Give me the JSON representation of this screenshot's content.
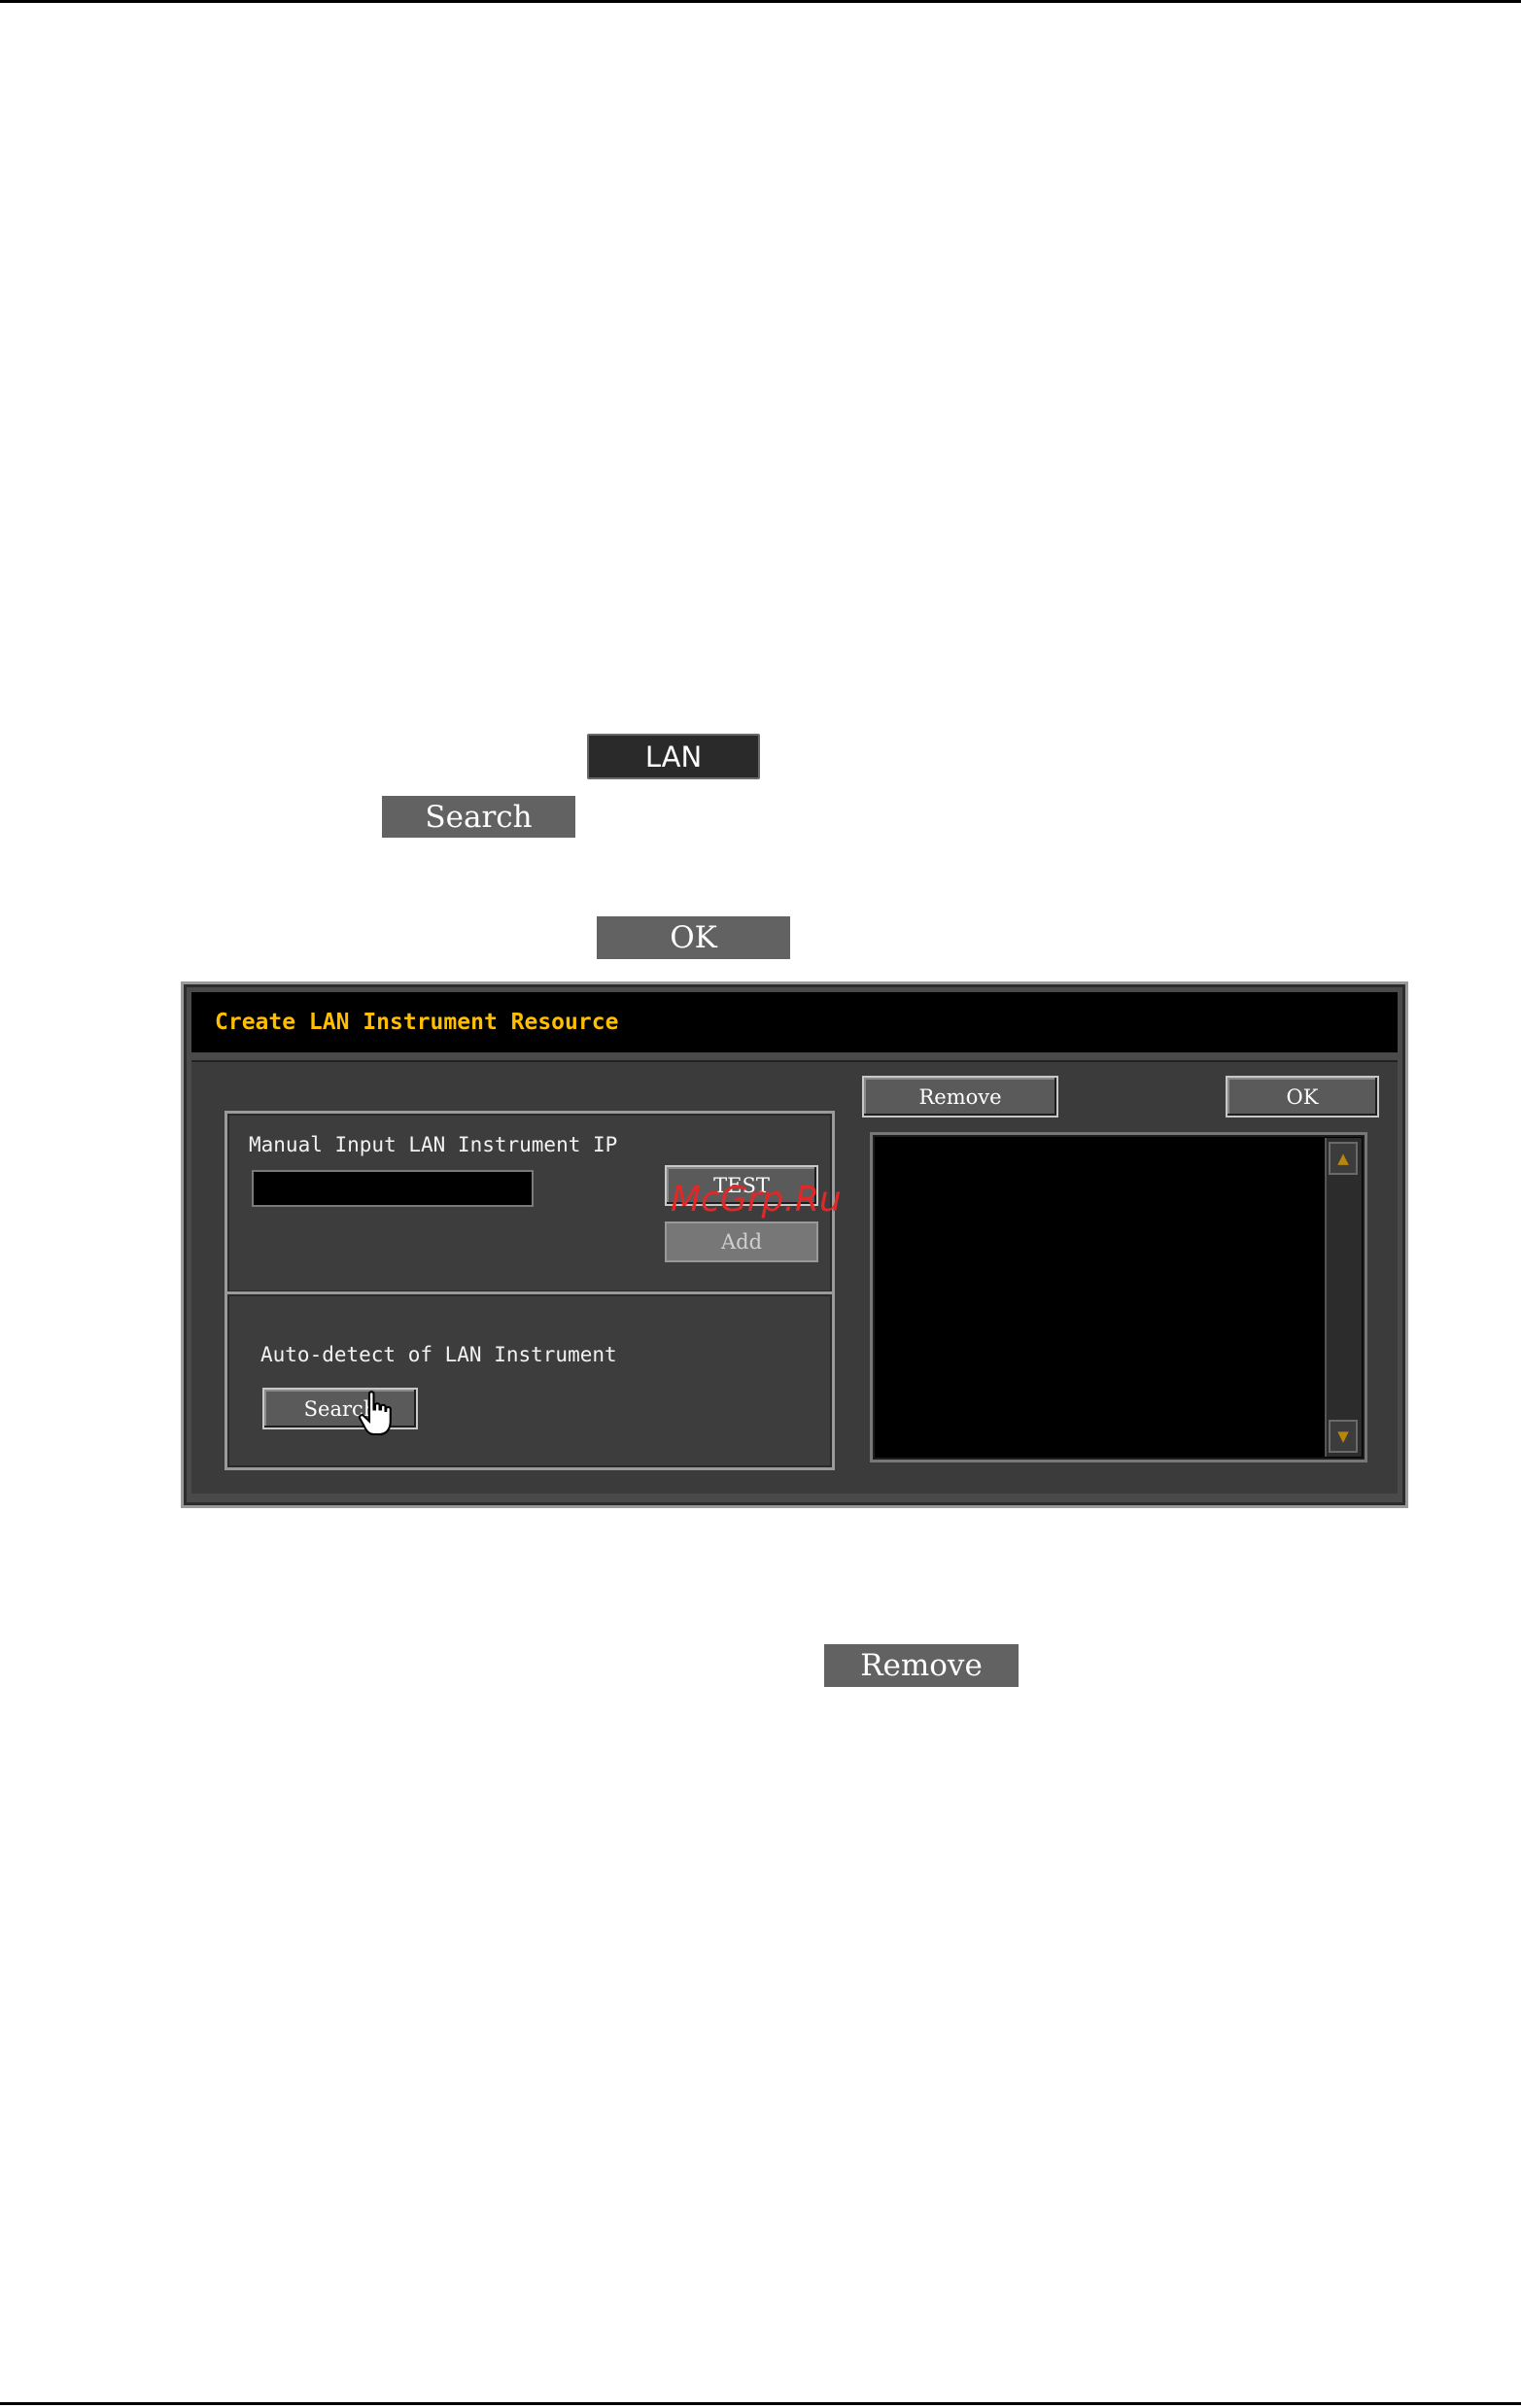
{
  "inline_buttons": {
    "lan": "LAN",
    "search": "Search",
    "ok": "OK",
    "remove": "Remove"
  },
  "dialog": {
    "title": "Create LAN Instrument Resource",
    "manual_label": "Manual Input LAN Instrument IP",
    "ip_value": "",
    "test_label": "TEST",
    "add_label": "Add",
    "auto_label": "Auto-detect of LAN Instrument",
    "search_label": "Search",
    "remove_label": "Remove",
    "ok_label": "OK",
    "scroll_up": "▲",
    "scroll_down": "▼"
  },
  "watermark": "McGrp.Ru",
  "colors": {
    "title_text": "#ffbf00",
    "dialog_bg": "#3b3b3b",
    "watermark": "#e02828"
  },
  "icons": {
    "cursor": "hand-pointer-icon"
  }
}
